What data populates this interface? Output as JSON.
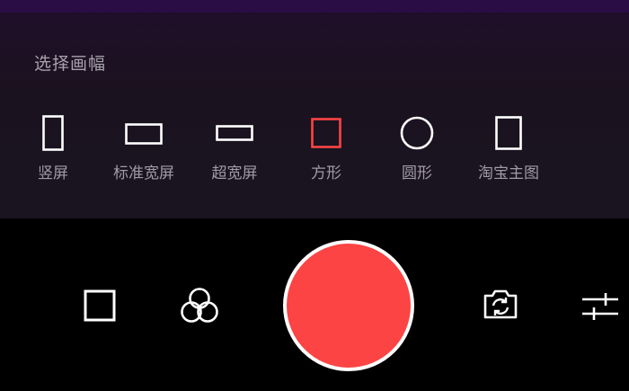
{
  "panel": {
    "title": "选择画幅"
  },
  "ratios": [
    {
      "label": "竖屏",
      "selected": false,
      "icon": "portrait-frame-icon"
    },
    {
      "label": "标准宽屏",
      "selected": false,
      "icon": "widescreen-frame-icon"
    },
    {
      "label": "超宽屏",
      "selected": false,
      "icon": "ultrawide-frame-icon"
    },
    {
      "label": "方形",
      "selected": true,
      "icon": "square-frame-icon"
    },
    {
      "label": "圆形",
      "selected": false,
      "icon": "circle-frame-icon"
    },
    {
      "label": "淘宝主图",
      "selected": false,
      "icon": "taobao-frame-icon"
    }
  ],
  "controls": {
    "aspect_icon": "square-aspect-icon",
    "filter_icon": "filter-circles-icon",
    "shutter_icon": "record-button",
    "flip_icon": "flip-camera-icon",
    "settings_icon": "sliders-icon"
  },
  "colors": {
    "accent": "#fb4443",
    "panel_bg": "#1b1220",
    "top_strip": "#2a0d44",
    "text": "#a09ba6"
  }
}
